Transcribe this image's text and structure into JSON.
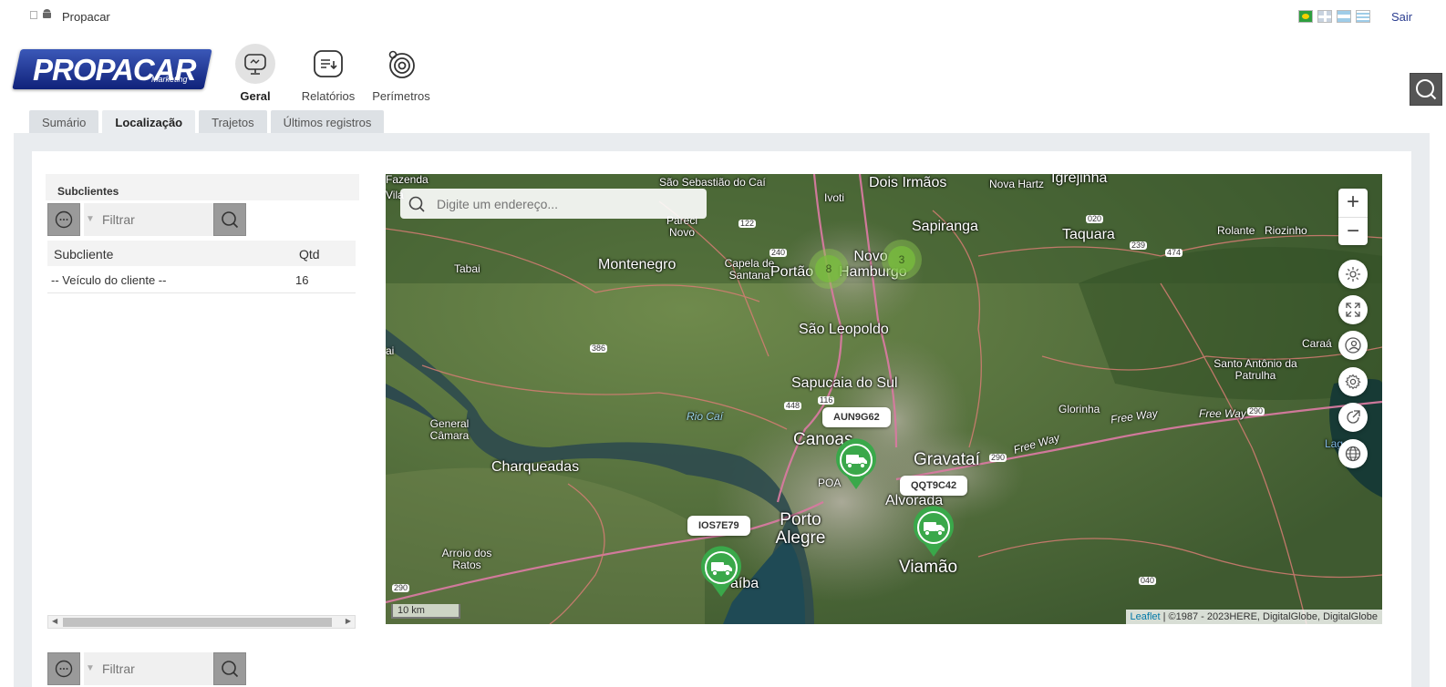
{
  "app": {
    "name": "Propacar",
    "logout": "Sair"
  },
  "logo": {
    "text": "PROPACAR",
    "sub": "Marketing"
  },
  "nav": [
    {
      "label": "Geral",
      "icon": "monitor-icon"
    },
    {
      "label": "Relatórios",
      "icon": "report-icon"
    },
    {
      "label": "Perímetros",
      "icon": "target-icon"
    }
  ],
  "tabs": [
    {
      "label": "Sumário"
    },
    {
      "label": "Localização"
    },
    {
      "label": "Trajetos"
    },
    {
      "label": "Últimos registros"
    }
  ],
  "subclients": {
    "title": "Subclientes",
    "filter_placeholder": "Filtrar",
    "columns": [
      "Subcliente",
      "Qtd"
    ],
    "rows": [
      {
        "name": "-- Veículo do cliente --",
        "qtd": "16"
      }
    ]
  },
  "bottom_filter": {
    "placeholder": "Filtrar"
  },
  "map": {
    "search_placeholder": "Digite um endereço...",
    "zoom_in": "+",
    "zoom_out": "−",
    "scale": "10 km",
    "attribution_link": "Leaflet",
    "attribution_text": "| ©1987 - 2023HERE, DigitalGlobe, DigitalGlobe",
    "clusters": [
      "8",
      "3"
    ],
    "vehicles": [
      {
        "plate": "AUN9G62"
      },
      {
        "plate": "QQT9C42"
      },
      {
        "plate": "IOS7E79"
      }
    ],
    "labels": {
      "sao_sebastiao": "São Sebastião do Caí",
      "dois_irmaos": "Dois Irmãos",
      "nova_hartz": "Nova Hartz",
      "igrejinha": "Igrejinha",
      "ivoti": "Ivoti",
      "sapiranga": "Sapiranga",
      "taquara": "Taquara",
      "rolante": "Rolante",
      "riozinho": "Riozinho",
      "pareci": "Pareci Novo",
      "tabai": "Tabai",
      "montenegro": "Montenegro",
      "capela": "Capela de Santana",
      "portao": "Portão",
      "novo_hamburgo": "Novo Hamburgo",
      "sao_leopoldo": "São Leopoldo",
      "santo_antonio": "Santo Antônio da Patrulha",
      "caraa": "Caraá",
      "sapucaia": "Sapucaia do Sul",
      "glorinha": "Glorinha",
      "general_camara": "General Câmara",
      "rio_cai": "Rio Caí",
      "canoas": "Canoas",
      "gravatai": "Gravataí",
      "charqueadas": "Charqueadas",
      "alvorada": "Alvorada",
      "poa": "POA",
      "porto_alegre": "Porto Alegre",
      "arroio": "Arroio dos Ratos",
      "viamao": "Viamão",
      "guaiba": "aíba",
      "free_way1": "Free Way",
      "free_way2": "Free Way",
      "free_way3": "Free Way",
      "lagoa": "Lag... s",
      "r122": "122",
      "r240": "240",
      "r020": "020",
      "r239": "239",
      "r474": "474",
      "r386": "386",
      "r448": "448",
      "r116": "116",
      "r290a": "290",
      "r290b": "290",
      "r290c": "290",
      "r040": "040",
      "ai": "ai",
      "fazenda": "Fazenda",
      "vila": "Vila"
    }
  }
}
